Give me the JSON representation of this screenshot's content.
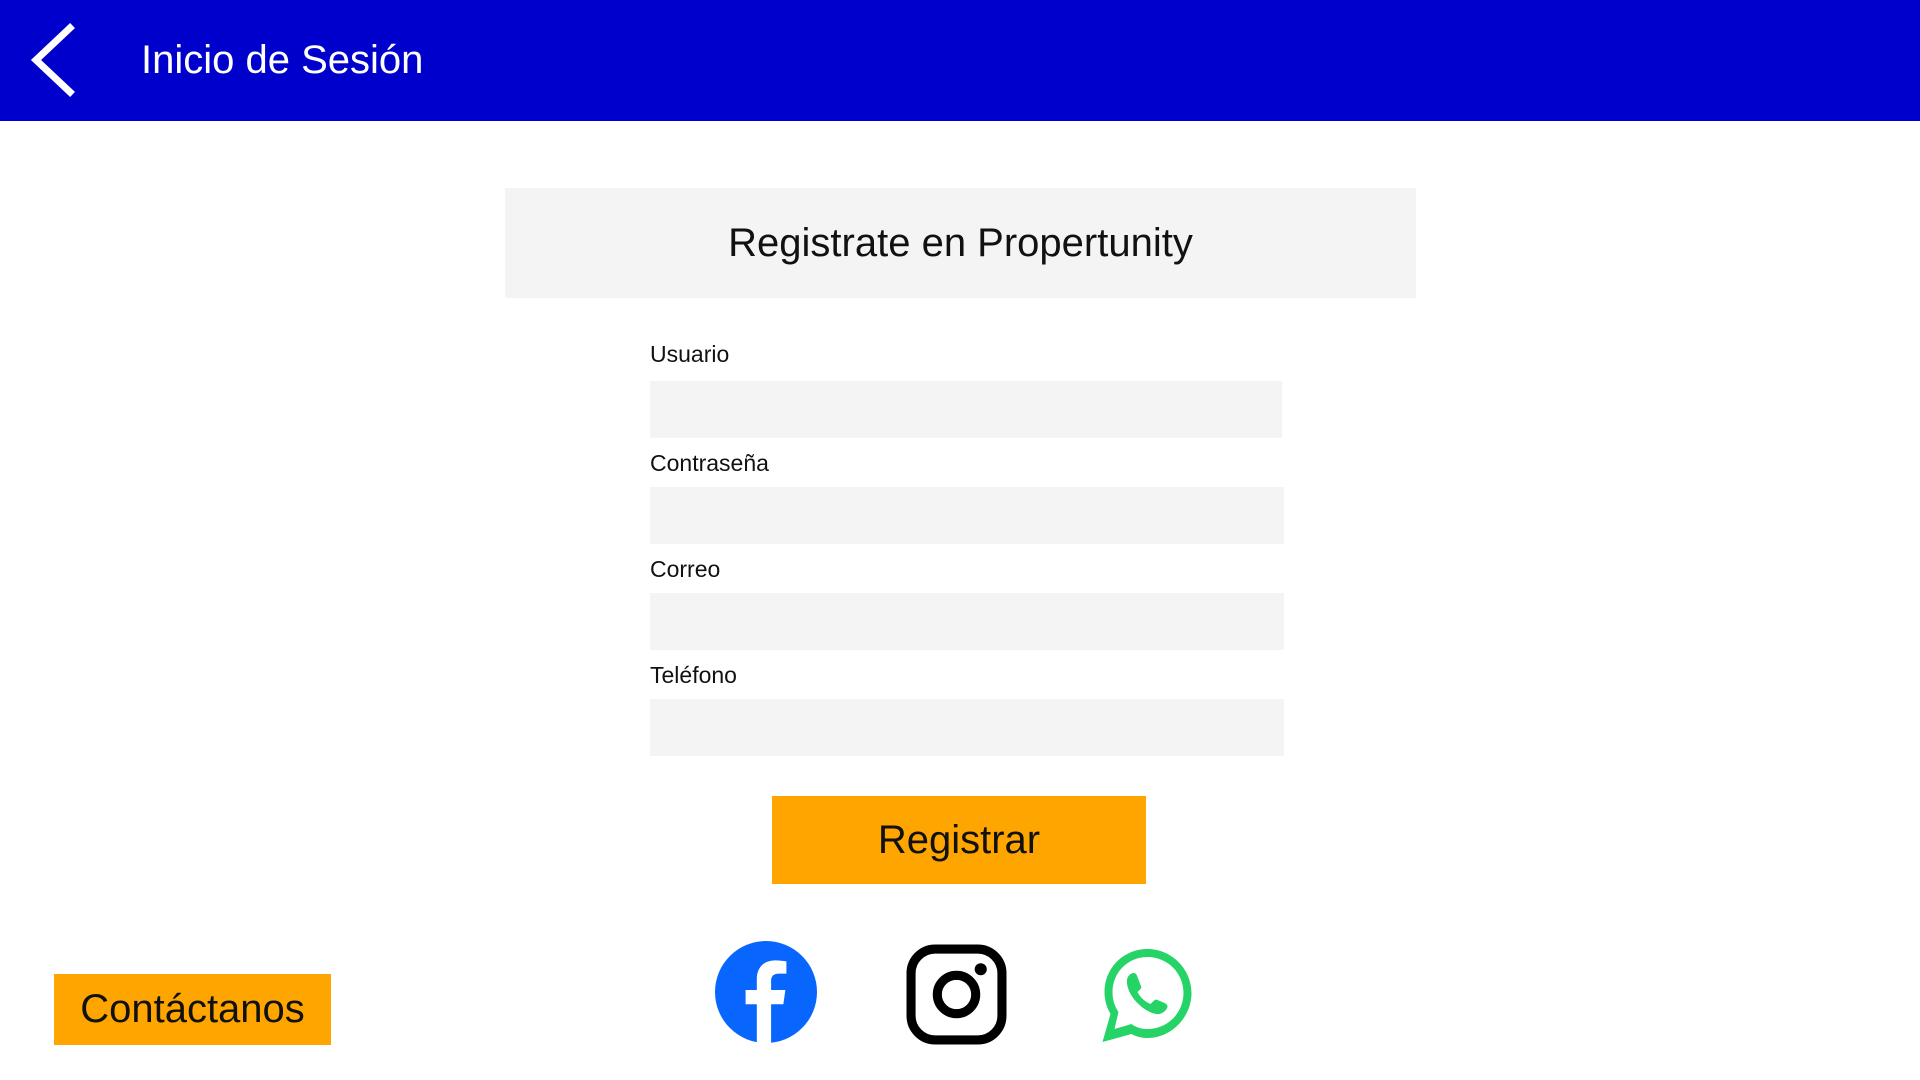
{
  "header": {
    "title": "Inicio de Sesión",
    "background_color": "#0000CC",
    "back_icon": "chevron-left-icon"
  },
  "form": {
    "title": "Registrate en Propertunity",
    "fields": [
      {
        "label": "Usuario",
        "value": "",
        "placeholder": ""
      },
      {
        "label": "Contraseña",
        "value": "",
        "placeholder": ""
      },
      {
        "label": "Correo",
        "value": "",
        "placeholder": ""
      },
      {
        "label": "Teléfono",
        "value": "",
        "placeholder": ""
      }
    ],
    "submit_label": "Registrar",
    "field_background": "#F4F4F4"
  },
  "footer": {
    "contact_label": "Contáctanos",
    "accent_color": "#FFA500",
    "social": [
      {
        "name": "facebook",
        "icon": "facebook-icon",
        "color": "#0866FF"
      },
      {
        "name": "instagram",
        "icon": "instagram-icon",
        "color": "#000000"
      },
      {
        "name": "whatsapp",
        "icon": "whatsapp-icon",
        "color": "#25D366"
      }
    ]
  }
}
